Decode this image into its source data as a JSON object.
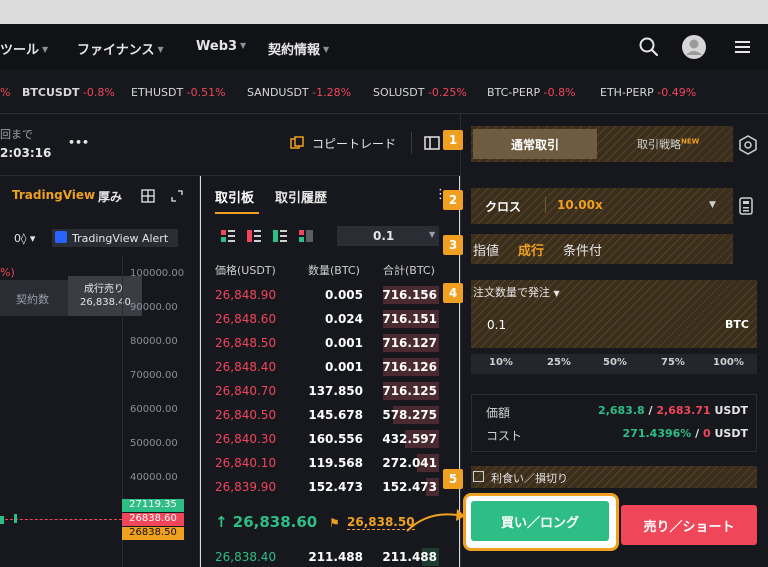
{
  "nav": {
    "items": [
      {
        "label": "ツール"
      },
      {
        "label": "ファイナンス"
      },
      {
        "label": "Web3"
      },
      {
        "label": "契約情報"
      }
    ]
  },
  "ticker": {
    "lead_change": "%",
    "items": [
      {
        "symbol": "BTCUSDT",
        "change": "-0.8%"
      },
      {
        "symbol": "ETHUSDT",
        "change": "-0.51%"
      },
      {
        "symbol": "SANDUSDT",
        "change": "-1.28%"
      },
      {
        "symbol": "SOLUSDT",
        "change": "-0.25%"
      },
      {
        "symbol": "BTC-PERP",
        "change": "-0.8%"
      },
      {
        "symbol": "ETH-PERP",
        "change": "-0.49%"
      }
    ]
  },
  "toolbar": {
    "countdown_label": "回まで",
    "countdown": "2:03:16",
    "more": "•••",
    "copy_trade": "コピートレード"
  },
  "chart": {
    "tab_tradingview": "TradingView",
    "tab_depth": "厚み",
    "indicator": "0◊ ▾",
    "alert": "TradingView Alert",
    "pct_label": "%)",
    "tooltip_left": "契約数",
    "tooltip_title": "成行売り",
    "tooltip_value": "26,838.40",
    "y_labels": [
      "100000.00",
      "90000.00",
      "80000.00",
      "70000.00",
      "60000.00",
      "50000.00",
      "40000.00"
    ],
    "price_tag_green": "27119.35",
    "price_tag_red": "26838.60",
    "price_tag_orange": "26838.50"
  },
  "orderbook": {
    "tab_active": "取引板",
    "tab_history": "取引履歴",
    "precision": "0.1",
    "headers": {
      "price": "価格(USDT)",
      "qty": "数量(BTC)",
      "total": "合計(BTC)"
    },
    "asks": [
      {
        "price": "26,848.90",
        "qty": "0.005",
        "total": "716.156",
        "depth": 0.85
      },
      {
        "price": "26,848.60",
        "qty": "0.024",
        "total": "716.151",
        "depth": 0.85
      },
      {
        "price": "26,848.50",
        "qty": "0.001",
        "total": "716.127",
        "depth": 0.85
      },
      {
        "price": "26,848.40",
        "qty": "0.001",
        "total": "716.126",
        "depth": 0.85
      },
      {
        "price": "26,840.70",
        "qty": "137.850",
        "total": "716.125",
        "depth": 0.85
      },
      {
        "price": "26,840.50",
        "qty": "145.678",
        "total": "578.275",
        "depth": 0.69
      },
      {
        "price": "26,840.30",
        "qty": "160.556",
        "total": "432.597",
        "depth": 0.52
      },
      {
        "price": "26,840.10",
        "qty": "119.568",
        "total": "272.041",
        "depth": 0.33
      },
      {
        "price": "26,839.90",
        "qty": "152.473",
        "total": "152.473",
        "depth": 0.19
      }
    ],
    "last_price": "↑ 26,838.60",
    "mark_price": "26,838.50",
    "bids": [
      {
        "price": "26,838.40",
        "qty": "211.488",
        "total": "211.488",
        "depth": 0.25
      }
    ]
  },
  "order": {
    "tab_normal": "通常取引",
    "tab_strategy": "取引戦略",
    "new_badge": "NEW",
    "margin_mode": "クロス",
    "leverage": "10.00x",
    "order_types": {
      "limit": "指値",
      "market": "成行",
      "conditional": "条件付"
    },
    "qty_mode": "注文数量で発注",
    "qty_value": "0.1",
    "qty_unit": "BTC",
    "percents": [
      "10%",
      "25%",
      "50%",
      "75%",
      "100%"
    ],
    "value_label": "価額",
    "value_green": "2,683.8",
    "value_sep": " / ",
    "value_red": "2,683.71",
    "value_unit": "USDT",
    "cost_label": "コスト",
    "cost_green": "271.4396%",
    "cost_sep": " / ",
    "cost_red": "0",
    "cost_unit": "USDT",
    "tpsl": "利食い／損切り",
    "buy": "買い／ロング",
    "sell": "売り／ショート"
  },
  "steps": [
    "1",
    "2",
    "3",
    "4",
    "5"
  ]
}
